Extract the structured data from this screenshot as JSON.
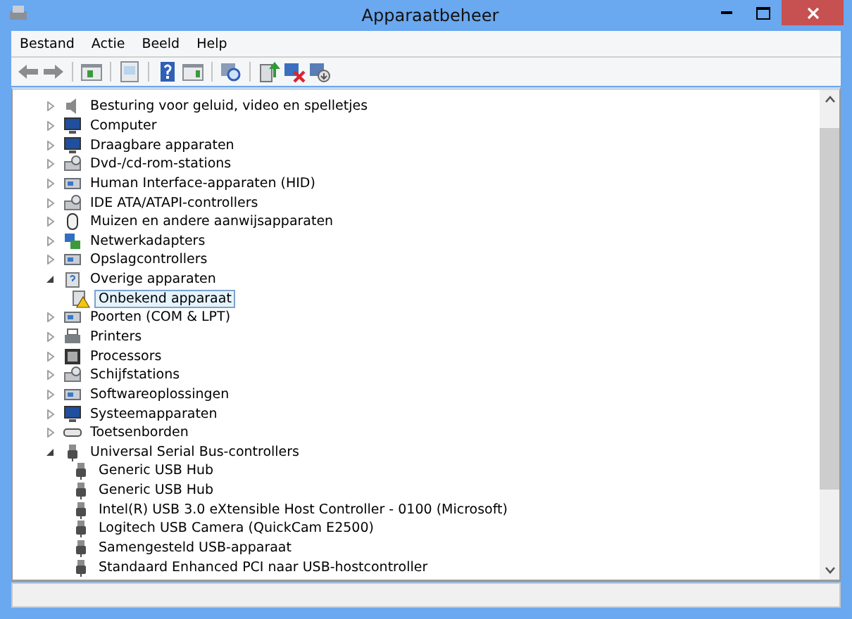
{
  "window": {
    "title": "Apparaatbeheer"
  },
  "menu": [
    "Bestand",
    "Actie",
    "Beeld",
    "Help"
  ],
  "toolbar": [
    {
      "kind": "back"
    },
    {
      "kind": "forward"
    },
    {
      "kind": "sep"
    },
    {
      "kind": "tree"
    },
    {
      "kind": "sep"
    },
    {
      "kind": "props"
    },
    {
      "kind": "sep"
    },
    {
      "kind": "help"
    },
    {
      "kind": "pane"
    },
    {
      "kind": "sep"
    },
    {
      "kind": "scan"
    },
    {
      "kind": "sep"
    },
    {
      "kind": "update"
    },
    {
      "kind": "uninstall"
    },
    {
      "kind": "disable"
    }
  ],
  "tree": [
    {
      "label": "Besturing voor geluid, video en spelletjes",
      "kind": "speaker",
      "expanded": false,
      "selected": false
    },
    {
      "label": "Computer",
      "kind": "monitor",
      "expanded": false,
      "selected": false
    },
    {
      "label": "Draagbare apparaten",
      "kind": "monitor",
      "expanded": false,
      "selected": false
    },
    {
      "label": "Dvd-/cd-rom-stations",
      "kind": "drive",
      "expanded": false,
      "selected": false
    },
    {
      "label": "Human Interface-apparaten (HID)",
      "kind": "generic",
      "expanded": false,
      "selected": false
    },
    {
      "label": "IDE ATA/ATAPI-controllers",
      "kind": "drive",
      "expanded": false,
      "selected": false
    },
    {
      "label": "Muizen en andere aanwijsapparaten",
      "kind": "mouse",
      "expanded": false,
      "selected": false
    },
    {
      "label": "Netwerkadapters",
      "kind": "network",
      "expanded": false,
      "selected": false
    },
    {
      "label": "Opslagcontrollers",
      "kind": "generic",
      "expanded": false,
      "selected": false
    },
    {
      "label": "Overige apparaten",
      "kind": "unknown",
      "expanded": true,
      "selected": false,
      "children": [
        {
          "label": "Onbekend apparaat",
          "kind": "warning",
          "selected": true
        }
      ]
    },
    {
      "label": "Poorten (COM & LPT)",
      "kind": "generic",
      "expanded": false,
      "selected": false
    },
    {
      "label": "Printers",
      "kind": "printer",
      "expanded": false,
      "selected": false
    },
    {
      "label": "Processors",
      "kind": "chip",
      "expanded": false,
      "selected": false
    },
    {
      "label": "Schijfstations",
      "kind": "drive",
      "expanded": false,
      "selected": false
    },
    {
      "label": "Softwareoplossingen",
      "kind": "generic",
      "expanded": false,
      "selected": false
    },
    {
      "label": "Systeemapparaten",
      "kind": "monitor",
      "expanded": false,
      "selected": false
    },
    {
      "label": "Toetsenborden",
      "kind": "keyboard",
      "expanded": false,
      "selected": false
    },
    {
      "label": "Universal Serial Bus-controllers",
      "kind": "usb",
      "expanded": true,
      "selected": false,
      "children": [
        {
          "label": "Generic USB Hub",
          "kind": "usb",
          "selected": false
        },
        {
          "label": "Generic USB Hub",
          "kind": "usb",
          "selected": false
        },
        {
          "label": "Intel(R) USB 3.0 eXtensible Host Controller - 0100 (Microsoft)",
          "kind": "usb",
          "selected": false
        },
        {
          "label": "Logitech USB Camera (QuickCam E2500)",
          "kind": "usb",
          "selected": false
        },
        {
          "label": "Samengesteld USB-apparaat",
          "kind": "usb",
          "selected": false
        },
        {
          "label": "Standaard Enhanced PCI naar USB-hostcontroller",
          "kind": "usb",
          "selected": false
        }
      ]
    }
  ]
}
